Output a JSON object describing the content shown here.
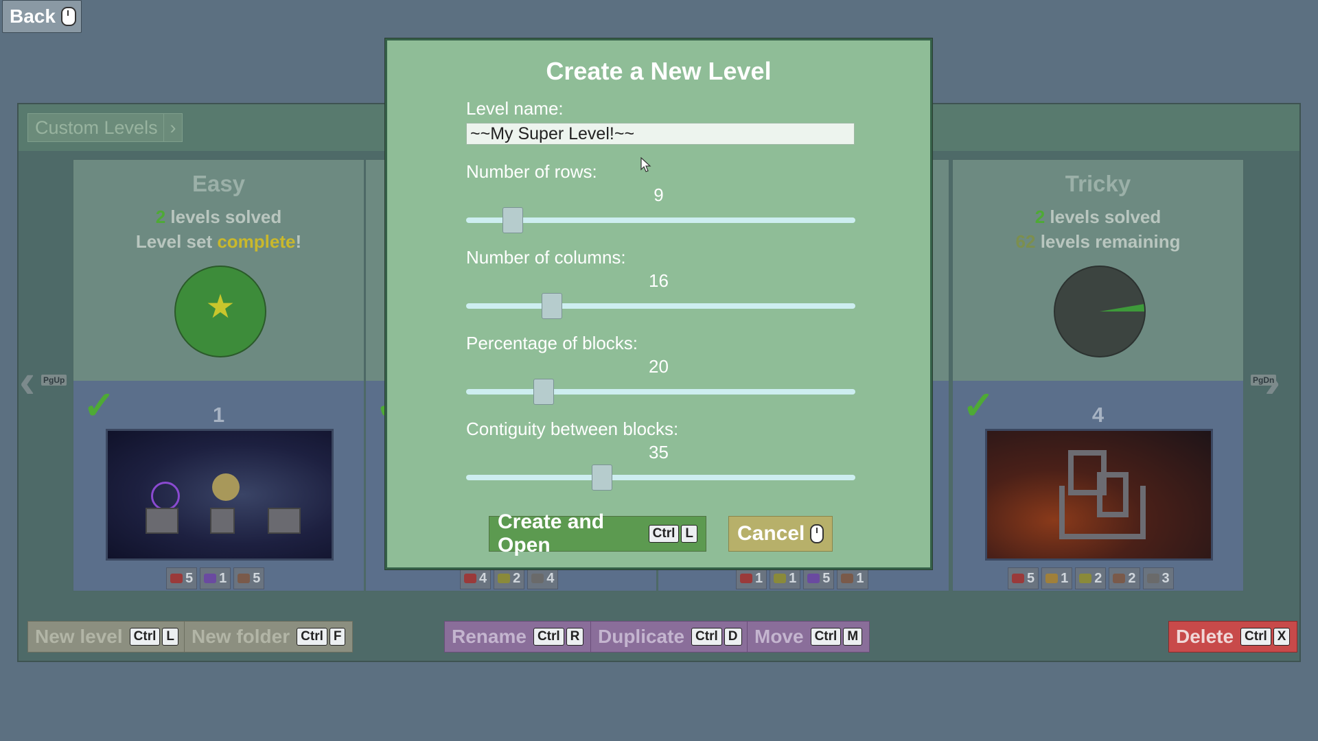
{
  "back": {
    "label": "Back"
  },
  "breadcrumb": {
    "label": "Custom Levels",
    "arrow": "›"
  },
  "nav": {
    "prev_key": "PgUp",
    "next_key": "PgDn"
  },
  "sets": [
    {
      "title": "Easy",
      "solved_count": "2",
      "solved_text": " levels solved",
      "line2_prefix": "Level set ",
      "line2_highlight": "complete",
      "line2_suffix": "!",
      "level_number": "1",
      "counts": [
        "5",
        "1",
        "5"
      ]
    },
    {
      "title": "Tricky",
      "solved_count": "2",
      "solved_text": " levels solved",
      "remaining_count": "62",
      "remaining_text": " levels remaining",
      "level_number": "4",
      "counts": [
        "5",
        "1",
        "2",
        "2",
        "3"
      ]
    }
  ],
  "hidden_counts": {
    "col2": [
      "4",
      "2",
      "4"
    ],
    "col3": [
      "1",
      "1",
      "5",
      "1"
    ]
  },
  "bottom_buttons": {
    "new_level": {
      "label": "New level",
      "keys": [
        "Ctrl",
        "L"
      ]
    },
    "new_folder": {
      "label": "New folder",
      "keys": [
        "Ctrl",
        "F"
      ]
    },
    "rename": {
      "label": "Rename",
      "keys": [
        "Ctrl",
        "R"
      ]
    },
    "duplicate": {
      "label": "Duplicate",
      "keys": [
        "Ctrl",
        "D"
      ]
    },
    "move": {
      "label": "Move",
      "keys": [
        "Ctrl",
        "M"
      ]
    },
    "delete": {
      "label": "Delete",
      "keys": [
        "Ctrl",
        "X"
      ]
    }
  },
  "dialog": {
    "title": "Create a New Level",
    "name_label": "Level name:",
    "name_value": "~~My Super Level!~~",
    "sliders": [
      {
        "label": "Number of rows:",
        "value": "9",
        "fraction": 0.12
      },
      {
        "label": "Number of columns:",
        "value": "16",
        "fraction": 0.22
      },
      {
        "label": "Percentage of blocks:",
        "value": "20",
        "fraction": 0.2
      },
      {
        "label": "Contiguity between blocks:",
        "value": "35",
        "fraction": 0.35
      }
    ],
    "create_button": {
      "label": "Create and Open",
      "keys": [
        "Ctrl",
        "L"
      ]
    },
    "cancel_button": {
      "label": "Cancel"
    }
  },
  "colors": {
    "complete": "#c9b82c",
    "solved": "#4eaa35",
    "remaining": "#7c8f4e",
    "delete": "#c84a4a"
  }
}
